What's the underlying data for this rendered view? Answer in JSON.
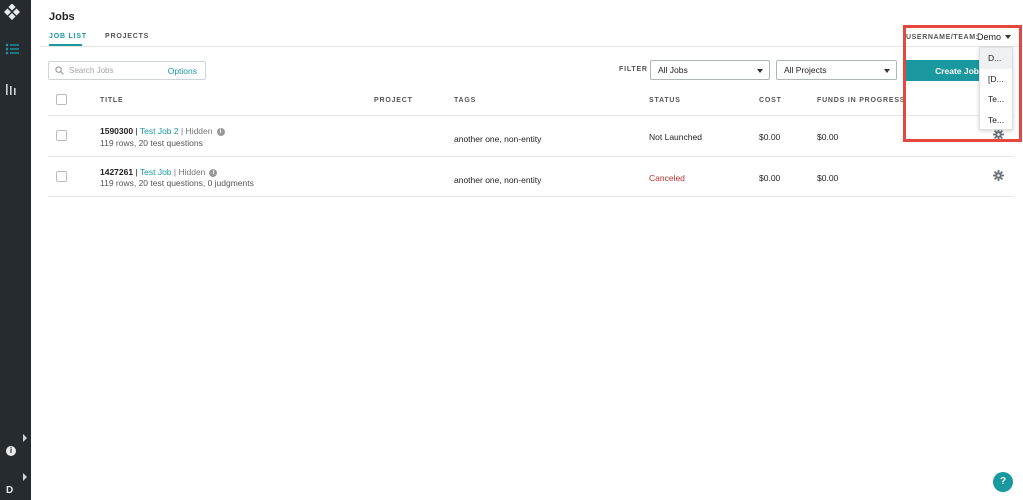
{
  "page": {
    "title": "Jobs"
  },
  "tabs": [
    {
      "label": "JOB LIST",
      "active": true
    },
    {
      "label": "PROJECTS",
      "active": false
    }
  ],
  "user_team": {
    "label": "USERNAME/TEAM:",
    "current": "Demo",
    "options": [
      "D...",
      "[D...",
      "Te...",
      "Te..."
    ]
  },
  "toolbar": {
    "search_placeholder": "Search Jobs",
    "options_label": "Options",
    "filter_label": "FILTER",
    "job_filter": "All Jobs",
    "project_filter": "All Projects",
    "create_label": "Create Job"
  },
  "table": {
    "headers": {
      "title": "TITLE",
      "project": "PROJECT",
      "tags": "TAGS",
      "status": "STATUS",
      "cost": "COST",
      "funds": "FUNDS IN PROGRESS"
    },
    "rows": [
      {
        "id": "1590300",
        "sep": " | ",
        "name": "Test Job 2",
        "visibility": " | Hidden",
        "summary": "119 rows, 20 test questions",
        "project": "",
        "tags": "another one, non-entity",
        "status": "Not Launched",
        "cost": "$0.00",
        "funds": "$0.00"
      },
      {
        "id": "1427261",
        "sep": " | ",
        "name": "Test Job",
        "visibility": " | Hidden",
        "summary": "119 rows, 20 test questions, 0 judgments",
        "project": "",
        "tags": "another one, non-entity",
        "status": "Canceled",
        "cost": "$0.00",
        "funds": "$0.00"
      }
    ]
  },
  "sidebar": {
    "user_initial": "D",
    "info_glyph": "i"
  },
  "help": {
    "label": "?"
  },
  "colors": {
    "accent": "#1a98a0",
    "sidebar": "#252b2f",
    "canceled": "#b5322c",
    "highlight": "#e5473f"
  }
}
